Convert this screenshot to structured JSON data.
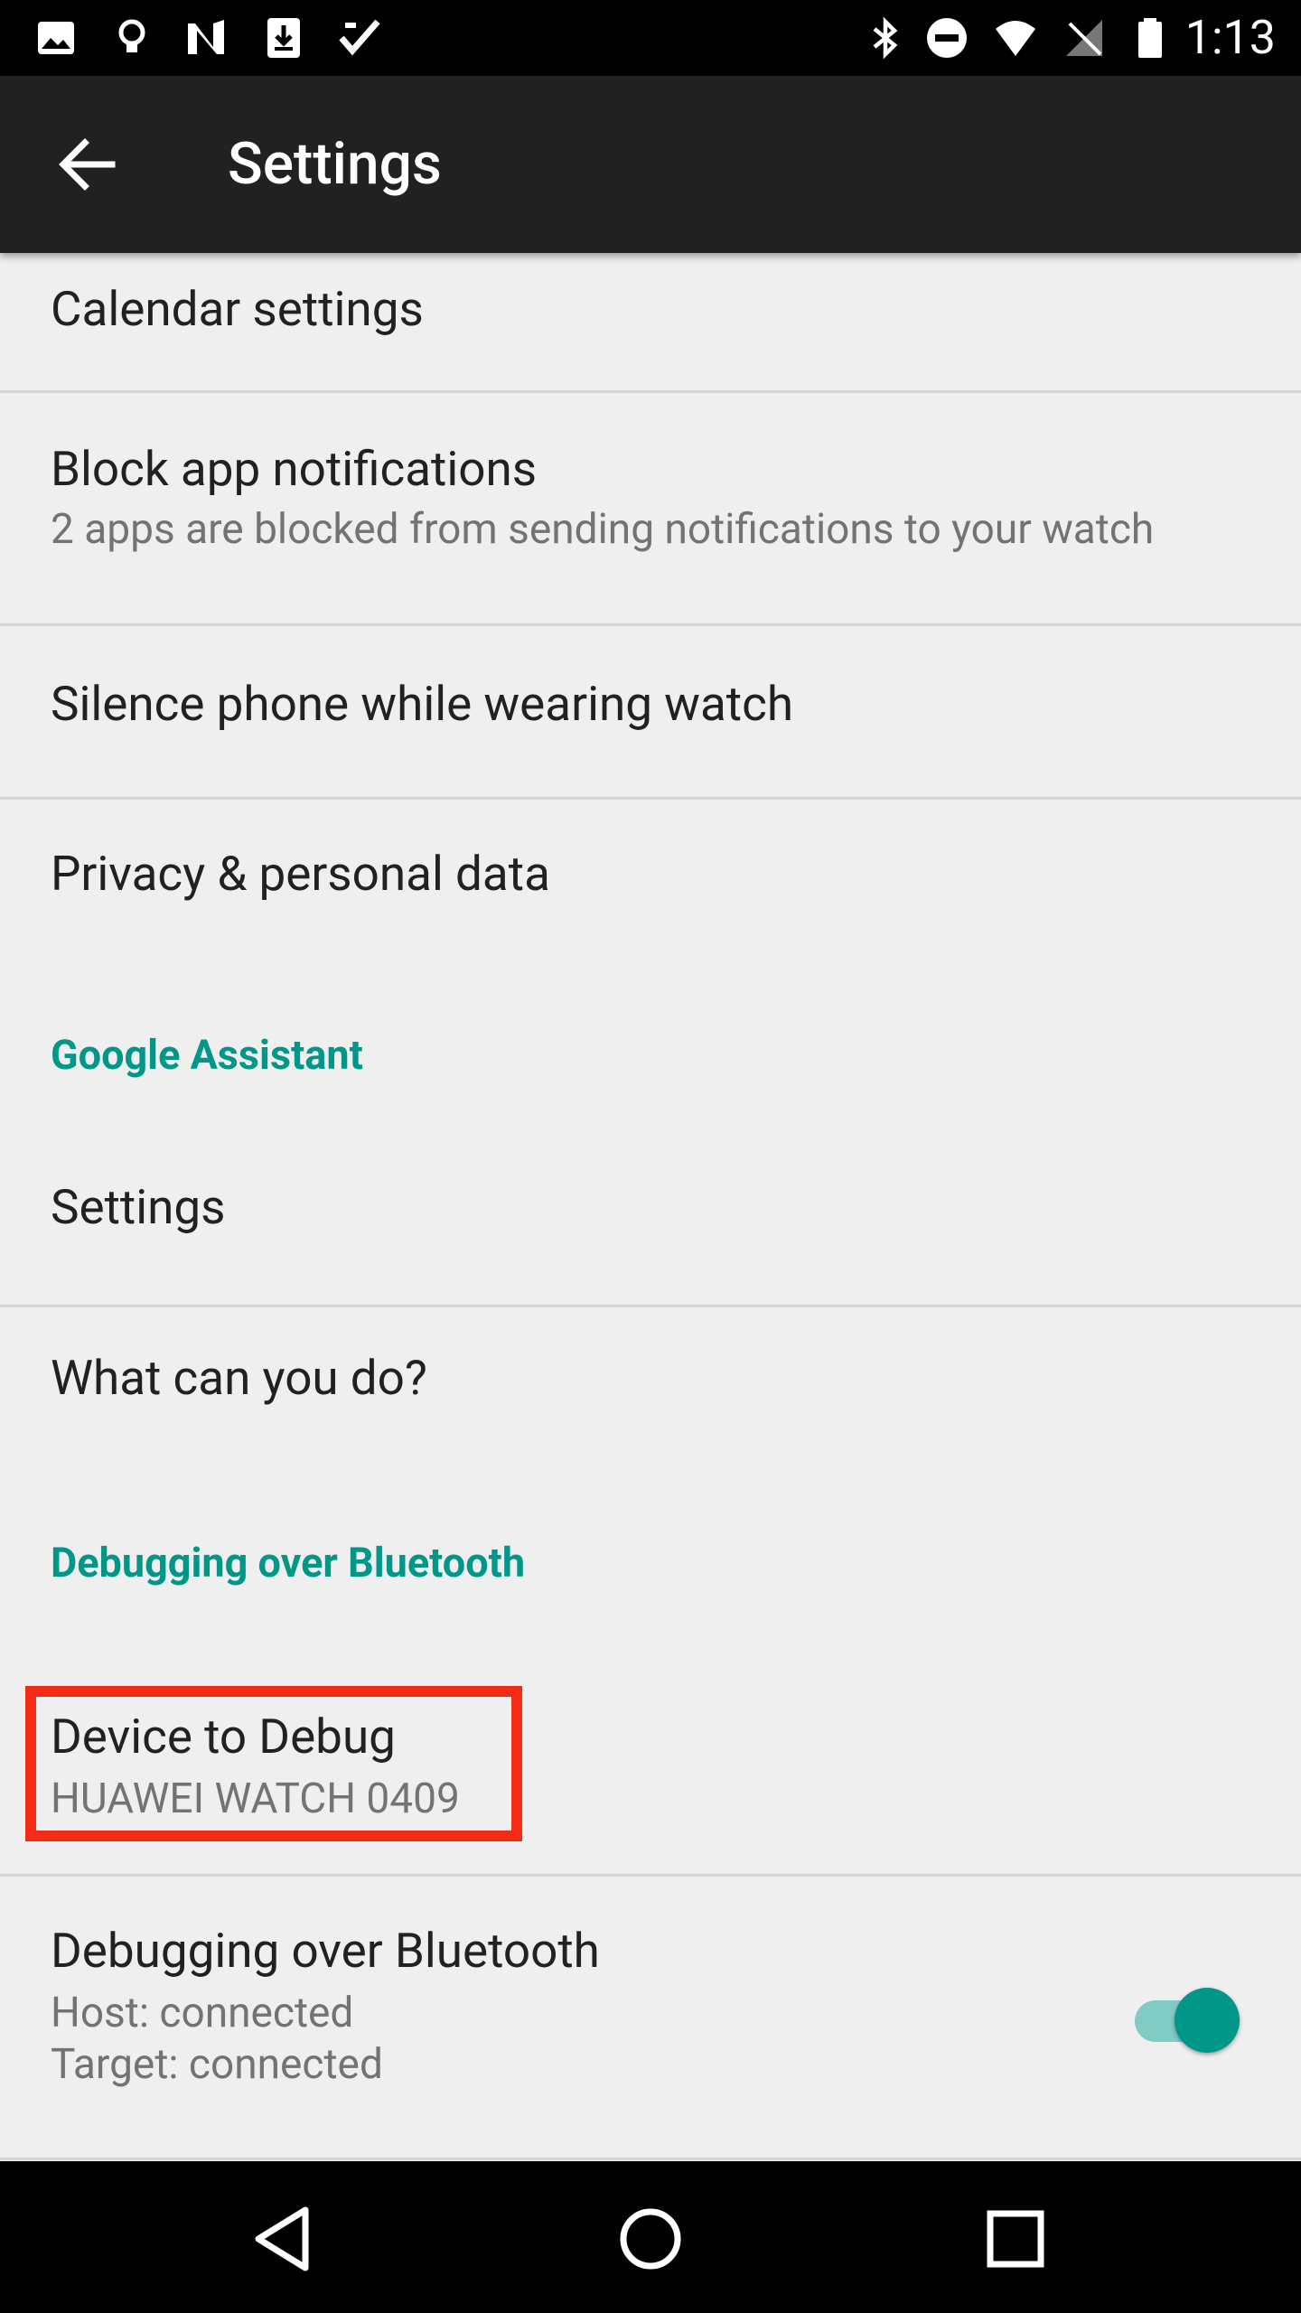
{
  "status_bar": {
    "time": "1:13",
    "left_icons": [
      "photo-icon",
      "lightbulb-icon",
      "n-icon",
      "download-icon",
      "check-app-icon"
    ],
    "right_icons": [
      "bluetooth-icon",
      "do-not-disturb-icon",
      "wifi-icon",
      "no-signal-icon",
      "battery-icon"
    ]
  },
  "app_bar": {
    "title": "Settings",
    "back_icon": "arrow-back-icon"
  },
  "items": {
    "calendar": {
      "title": "Calendar settings"
    },
    "block": {
      "title": "Block app notifications",
      "subtitle": "2 apps are blocked from sending notifications to your watch"
    },
    "silence": {
      "title": "Silence phone while wearing watch"
    },
    "privacy": {
      "title": "Privacy & personal data"
    },
    "assistant_header": "Google Assistant",
    "assistant_settings": {
      "title": "Settings"
    },
    "what_can_you_do": {
      "title": "What can you do?"
    },
    "debug_header": "Debugging over Bluetooth",
    "device_to_debug": {
      "title": "Device to Debug",
      "subtitle": "HUAWEI WATCH 0409"
    },
    "debug_bt": {
      "title": "Debugging over Bluetooth",
      "host": "Host: connected",
      "target": "Target: connected",
      "toggle_on": true
    }
  },
  "colors": {
    "accent": "#009688",
    "highlight": "#f42c16",
    "app_bar": "#212121",
    "background": "#efefef"
  },
  "nav_bar": {
    "icons": [
      "back-triangle-icon",
      "home-circle-icon",
      "recents-square-icon"
    ]
  }
}
